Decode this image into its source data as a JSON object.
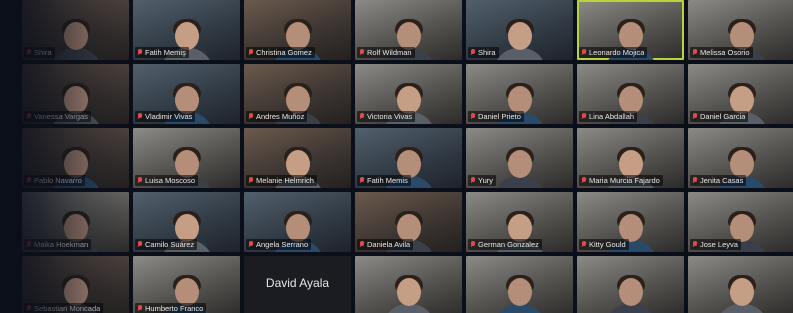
{
  "window": {
    "title": ""
  },
  "participants": [
    {
      "name": "Shira",
      "style": "warm"
    },
    {
      "name": "Fatih Memiş",
      "style": "cool"
    },
    {
      "name": "Christina Gomez",
      "style": "warm"
    },
    {
      "name": "Rolf Wildman",
      "style": "light"
    },
    {
      "name": "Shira",
      "style": "cool"
    },
    {
      "name": "Leonardo Mojica",
      "style": "light",
      "active": true
    },
    {
      "name": "Melissa Osorio",
      "style": "light"
    },
    {
      "name": "Vanessa Vargas",
      "style": "warm"
    },
    {
      "name": "Vladimir Vivas",
      "style": "cool"
    },
    {
      "name": "Andres Muñoz",
      "style": "warm"
    },
    {
      "name": "Victoria Vivas",
      "style": "light"
    },
    {
      "name": "Daniel Prieto",
      "style": "light"
    },
    {
      "name": "Lina Abdallah",
      "style": "light"
    },
    {
      "name": "Daniel Garcia",
      "style": "light"
    },
    {
      "name": "Pablo Navarro",
      "style": "warm"
    },
    {
      "name": "Luisa Moscoso",
      "style": "light"
    },
    {
      "name": "Melanie Helmrich",
      "style": "warm"
    },
    {
      "name": "Fatih Memis",
      "style": "cool"
    },
    {
      "name": "Yury",
      "style": "light"
    },
    {
      "name": "Maria Murcia Fajardo",
      "style": "light"
    },
    {
      "name": "Jenita Casas",
      "style": "light"
    },
    {
      "name": "Maika Hoekman",
      "style": "light"
    },
    {
      "name": "Camilo Suárez",
      "style": "cool"
    },
    {
      "name": "Angela Serrano",
      "style": "cool"
    },
    {
      "name": "Daniela Avila",
      "style": "warm"
    },
    {
      "name": "German Gonzalez",
      "style": "light"
    },
    {
      "name": "Kitty Gould",
      "style": "light"
    },
    {
      "name": "Jose Leyva",
      "style": "light"
    },
    {
      "name": "Sebastian Moncada",
      "style": "warm"
    },
    {
      "name": "Humberto Franco",
      "style": "light"
    },
    {
      "name": "",
      "style": "dark",
      "big": "David Ayala"
    },
    {
      "name": "",
      "style": "light"
    },
    {
      "name": "",
      "style": "light"
    },
    {
      "name": "",
      "style": "light"
    },
    {
      "name": "",
      "style": "light"
    }
  ]
}
